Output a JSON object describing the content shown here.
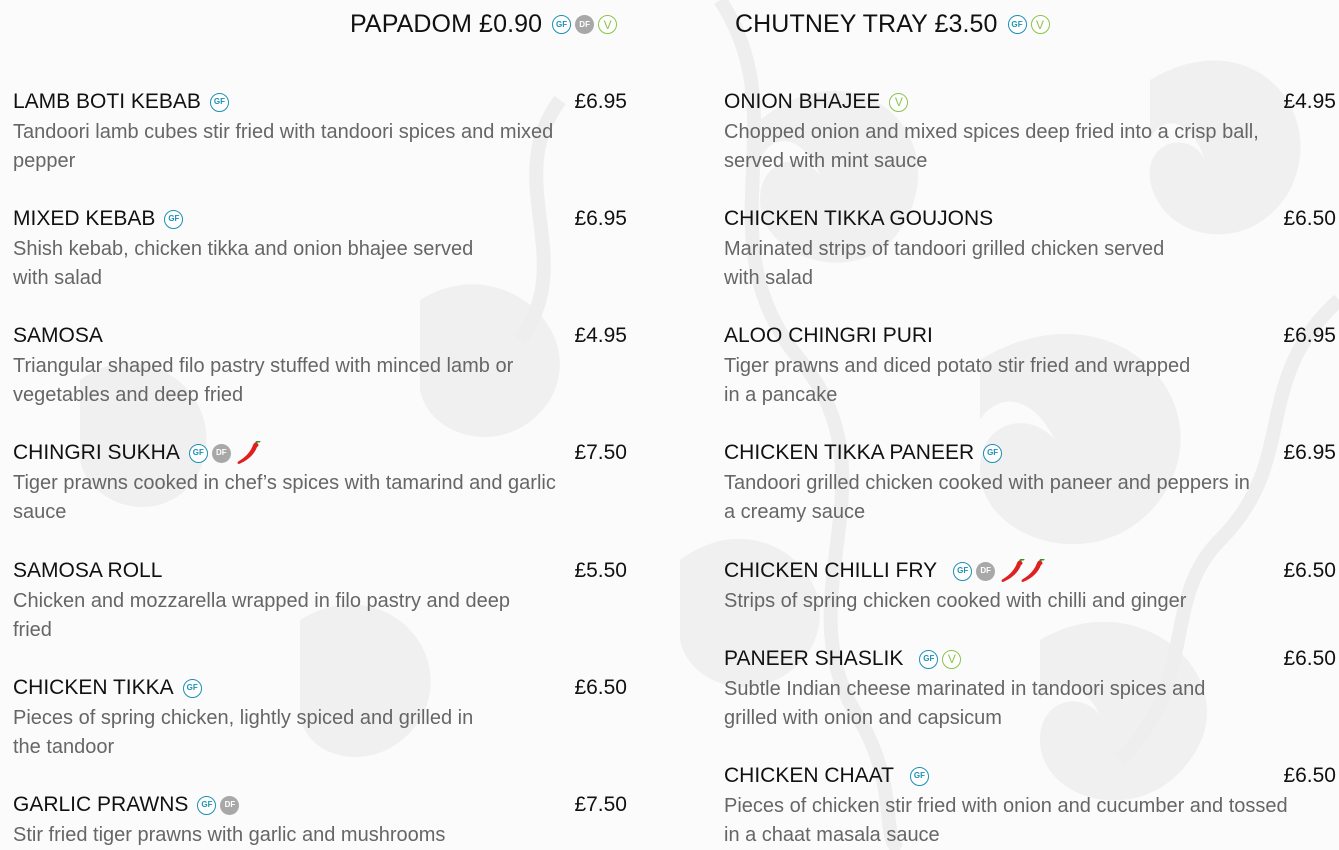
{
  "colors": {
    "gf": "#1c8fb5",
    "df": "#a8a8a8",
    "vegetarian": "#8bc34a",
    "chilli": "#e02020",
    "title_text": "#111111",
    "description_text": "#666666"
  },
  "extras": [
    {
      "label": "PAPADOM £0.90",
      "badges": [
        "gf-icon",
        "df-icon",
        "vegetarian-icon"
      ]
    },
    {
      "label": "CHUTNEY TRAY £3.50",
      "badges": [
        "gf-icon",
        "vegetarian-icon"
      ]
    }
  ],
  "badge_labels": {
    "gf": "GF",
    "df": "DF",
    "v": "V"
  },
  "left_column": [
    {
      "name": "LAMB BOTI KEBAB",
      "price": "£6.95",
      "description": "Tandoori lamb cubes stir fried with tandoori spices and mixed pepper",
      "badges": [
        "gf-icon"
      ]
    },
    {
      "name": "MIXED KEBAB",
      "price": "£6.95",
      "description": "Shish kebab, chicken tikka and onion bhajee served with salad",
      "badges": [
        "gf-icon"
      ]
    },
    {
      "name": "SAMOSA",
      "price": "£4.95",
      "description": "Triangular shaped filo pastry stuffed with minced lamb or vegetables and deep fried",
      "badges": []
    },
    {
      "name": "CHINGRI SUKHA",
      "price": "£7.50",
      "description": "Tiger prawns cooked in chef’s spices with tamarind and garlic sauce",
      "badges": [
        "gf-icon",
        "df-icon",
        "chilli-icon"
      ]
    },
    {
      "name": "SAMOSA ROLL",
      "price": "£5.50",
      "description": "Chicken and mozzarella wrapped in filo pastry and deep fried",
      "badges": []
    },
    {
      "name": "CHICKEN TIKKA",
      "price": "£6.50",
      "description": "Pieces of spring chicken, lightly spiced and grilled in the tandoor",
      "badges": [
        "gf-icon"
      ]
    },
    {
      "name": "GARLIC PRAWNS",
      "price": "£7.50",
      "description": "Stir fried tiger prawns with garlic and mushrooms",
      "badges": [
        "gf-icon",
        "df-icon"
      ]
    }
  ],
  "right_column": [
    {
      "name": "ONION BHAJEE",
      "price": "£4.95",
      "description": "Chopped onion and mixed spices deep fried into a crisp ball, served with mint sauce",
      "badges": [
        "vegetarian-icon"
      ]
    },
    {
      "name": "CHICKEN TIKKA GOUJONS",
      "price": "£6.50",
      "description": "Marinated strips of tandoori grilled chicken served with salad",
      "badges": []
    },
    {
      "name": "ALOO CHINGRI PURI",
      "price": "£6.95",
      "description": "Tiger prawns and diced potato stir fried and wrapped in a pancake",
      "badges": []
    },
    {
      "name": "CHICKEN TIKKA PANEER",
      "price": "£6.95",
      "description": "Tandoori grilled chicken cooked with paneer and peppers in a creamy sauce",
      "badges": [
        "gf-icon"
      ]
    },
    {
      "name": "CHICKEN CHILLI FRY",
      "price": "£6.50",
      "description": "Strips of spring chicken cooked with chilli and ginger",
      "badges": [
        "gf-icon",
        "df-icon",
        "chilli-icon",
        "chilli-icon"
      ]
    },
    {
      "name": "PANEER SHASLIK",
      "price": "£6.50",
      "description": "Subtle Indian cheese marinated in tandoori spices and grilled with onion and capsicum",
      "badges": [
        "gf-icon",
        "vegetarian-icon"
      ]
    },
    {
      "name": "CHICKEN CHAAT",
      "price": "£6.50",
      "description": "Pieces of chicken stir fried with onion and cucumber and tossed in a chaat masala sauce",
      "badges": [
        "gf-icon"
      ]
    }
  ]
}
